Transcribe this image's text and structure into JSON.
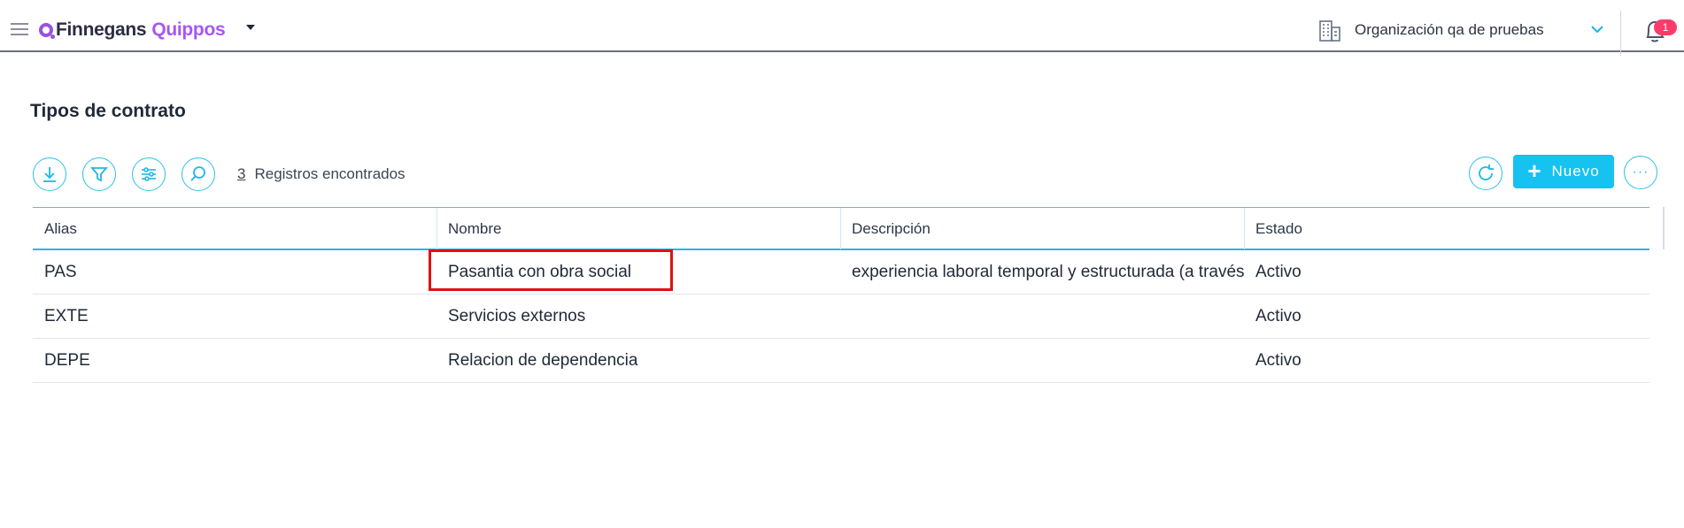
{
  "header": {
    "brand_part1": "Finnegans",
    "brand_part2": "Quippos",
    "organization": "Organización qa de pruebas",
    "notification_count": "1"
  },
  "page": {
    "title": "Tipos de contrato"
  },
  "toolbar": {
    "record_count": "3",
    "records_label": "Registros encontrados",
    "new_label": "Nuevo",
    "more_label": "···"
  },
  "table": {
    "columns": [
      "Alias",
      "Nombre",
      "Descripción",
      "Estado"
    ],
    "rows": [
      {
        "alias": "PAS",
        "nombre": "Pasantia con obra social",
        "descripcion": "experiencia laboral temporal y estructurada (a través",
        "estado": "Activo"
      },
      {
        "alias": "EXTE",
        "nombre": "Servicios externos",
        "descripcion": "",
        "estado": "Activo"
      },
      {
        "alias": "DEPE",
        "nombre": "Relacion de dependencia",
        "descripcion": "",
        "estado": "Activo"
      }
    ]
  },
  "colors": {
    "accent": "#16c2f0",
    "brand": "#a855f7",
    "badge": "#ff3b6b",
    "highlight": "#e01010"
  }
}
